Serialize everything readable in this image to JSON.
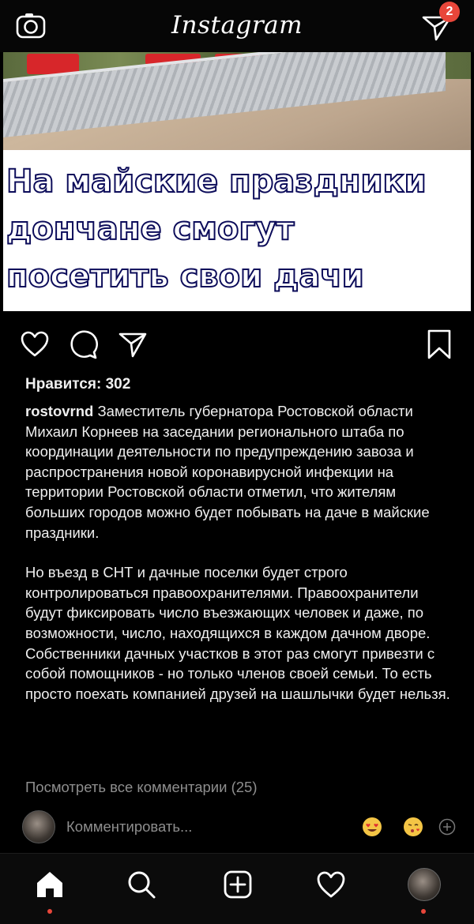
{
  "top_bar": {
    "logo_text": "Instagram",
    "camera_icon": "camera-icon",
    "direct_icon": "direct-message-icon",
    "direct_badge_count": "2",
    "badge_color": "#e8463a"
  },
  "post": {
    "headline_lines": [
      "На майские праздники",
      "дончане смогут",
      "посетить свои дачи"
    ],
    "actions": {
      "like_icon": "heart-icon",
      "comment_icon": "comment-icon",
      "share_icon": "share-icon",
      "save_icon": "bookmark-icon"
    },
    "likes_text": "Нравится: 302",
    "username": "rostovrnd",
    "caption_paragraph_1": "Заместитель губернатора Ростовской области Михаил Корнеев на заседании регионального штаба по координации деятельности по предупреждению завоза и распространения новой коронавирусной инфекции на территории Ростовской области отметил, что жителям больших городов можно будет побывать на даче в майские праздники.",
    "caption_paragraph_2": "Но въезд в СНТ и дачные поселки будет строго контролироваться правоохранителями. Правоохранители будут фиксировать число въезжающих человек и даже, по возможности, число, находящихся в каждом дачном дворе. Собственники дачных участков в этот раз смогут привезти с собой помощников - но только членов своей семьи. То есть просто поехать компанией друзей на шашлычки будет нельзя.",
    "view_comments": "Посмотреть все комментарии (25)",
    "comment_placeholder": "Комментировать...",
    "quick_reactions": [
      "heart-eyes-emoji",
      "kiss-emoji",
      "add-icon"
    ]
  },
  "bottom_nav": {
    "items": [
      "home-icon",
      "search-icon",
      "new-post-icon",
      "activity-icon",
      "profile-avatar"
    ],
    "active": "home-icon",
    "indicator_color": "#e8463a"
  }
}
